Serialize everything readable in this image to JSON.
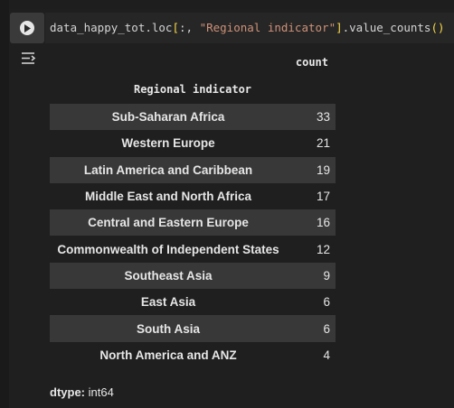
{
  "code": {
    "prefix": "data_happy_tot.loc",
    "open_bracket": "[",
    "slice": ":, ",
    "string_arg": "\"Regional indicator\"",
    "close_bracket": "]",
    "method": ".value_counts",
    "call_parens": "()"
  },
  "output": {
    "column_header": "count",
    "index_name": "Regional indicator",
    "rows": [
      {
        "label": "Sub-Saharan Africa",
        "value": "33"
      },
      {
        "label": "Western Europe",
        "value": "21"
      },
      {
        "label": "Latin America and Caribbean",
        "value": "19"
      },
      {
        "label": "Middle East and North Africa",
        "value": "17"
      },
      {
        "label": "Central and Eastern Europe",
        "value": "16"
      },
      {
        "label": "Commonwealth of Independent States",
        "value": "12"
      },
      {
        "label": "Southeast Asia",
        "value": "9"
      },
      {
        "label": "East Asia",
        "value": "6"
      },
      {
        "label": "South Asia",
        "value": "6"
      },
      {
        "label": "North America and ANZ",
        "value": "4"
      }
    ],
    "dtype_label": "dtype:",
    "dtype_value": "int64"
  },
  "icons": {
    "run": "play-circle-icon",
    "output_menu": "output-toggle-icon"
  },
  "colors": {
    "background": "#1e1e1e",
    "code_bracket": "#f9d849",
    "code_string": "#ce9178",
    "row_stripe": "#383838"
  }
}
